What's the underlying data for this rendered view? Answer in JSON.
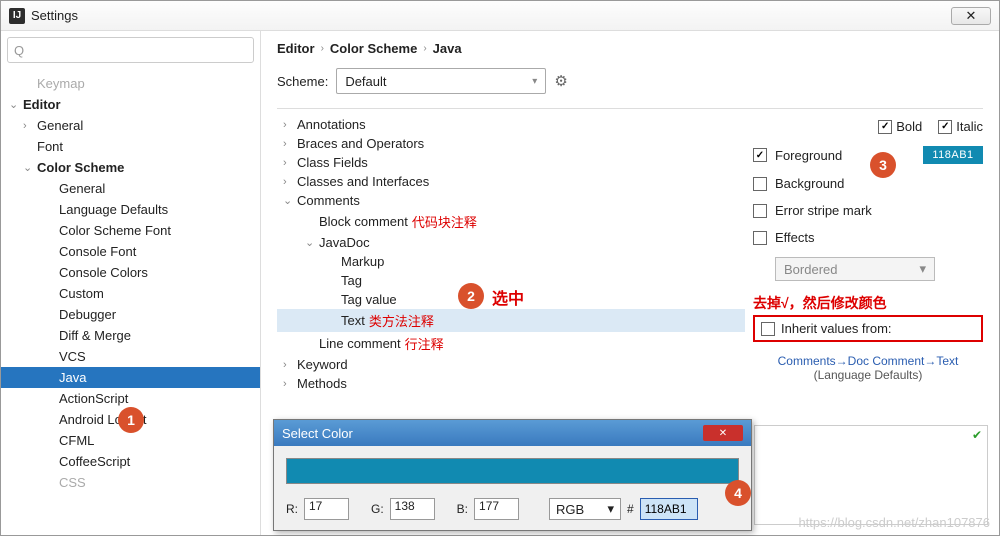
{
  "window": {
    "title": "Settings",
    "closeGlyph": "✕"
  },
  "search": {
    "placeholder": "Q"
  },
  "sidebar": {
    "items": [
      {
        "label": "Keymap",
        "depth": 1,
        "faded": true
      },
      {
        "label": "Editor",
        "depth": 0,
        "arrow": "v",
        "bold": true
      },
      {
        "label": "General",
        "depth": 1,
        "arrow": ">"
      },
      {
        "label": "Font",
        "depth": 1
      },
      {
        "label": "Color Scheme",
        "depth": 1,
        "arrow": "v",
        "bold": true
      },
      {
        "label": "General",
        "depth": 2
      },
      {
        "label": "Language Defaults",
        "depth": 2
      },
      {
        "label": "Color Scheme Font",
        "depth": 2
      },
      {
        "label": "Console Font",
        "depth": 2
      },
      {
        "label": "Console Colors",
        "depth": 2
      },
      {
        "label": "Custom",
        "depth": 2
      },
      {
        "label": "Debugger",
        "depth": 2
      },
      {
        "label": "Diff & Merge",
        "depth": 2
      },
      {
        "label": "VCS",
        "depth": 2
      },
      {
        "label": "Java",
        "depth": 2,
        "selected": true
      },
      {
        "label": "ActionScript",
        "depth": 2
      },
      {
        "label": "Android Logcat",
        "depth": 2
      },
      {
        "label": "CFML",
        "depth": 2
      },
      {
        "label": "CoffeeScript",
        "depth": 2
      },
      {
        "label": "CSS",
        "depth": 2,
        "faded": true
      }
    ]
  },
  "breadcrumb": {
    "a": "Editor",
    "b": "Color Scheme",
    "c": "Java"
  },
  "scheme": {
    "label": "Scheme:",
    "value": "Default"
  },
  "optionsTree": [
    {
      "label": "Annotations",
      "depth": 0,
      "arrow": ">"
    },
    {
      "label": "Braces and Operators",
      "depth": 0,
      "arrow": ">"
    },
    {
      "label": "Class Fields",
      "depth": 0,
      "arrow": ">"
    },
    {
      "label": "Classes and Interfaces",
      "depth": 0,
      "arrow": ">"
    },
    {
      "label": "Comments",
      "depth": 0,
      "arrow": "v"
    },
    {
      "label": "Block comment",
      "depth": 1,
      "note": "代码块注释"
    },
    {
      "label": "JavaDoc",
      "depth": 1,
      "arrow": "v"
    },
    {
      "label": "Markup",
      "depth": 2
    },
    {
      "label": "Tag",
      "depth": 2
    },
    {
      "label": "Tag value",
      "depth": 2
    },
    {
      "label": "Text",
      "depth": 2,
      "selected": true,
      "note": "类方法注释"
    },
    {
      "label": "Line comment",
      "depth": 1,
      "note": "行注释"
    },
    {
      "label": "Keyword",
      "depth": 0,
      "arrow": ">"
    },
    {
      "label": "Methods",
      "depth": 0,
      "arrow": ">"
    }
  ],
  "props": {
    "bold": "Bold",
    "italic": "Italic",
    "foreground": "Foreground",
    "fgColor": "118AB1",
    "background": "Background",
    "errorStripe": "Error stripe mark",
    "effects": "Effects",
    "effectsType": "Bordered",
    "inheritRed": "去掉√，然后修改颜色",
    "inheritLabel": "Inherit values from:",
    "linkPath": "Comments→Doc Comment→Text",
    "langDefaults": "(Language Defaults)"
  },
  "annotations": {
    "n1": "1",
    "n2": "2",
    "n2txt": "选中",
    "n3": "3",
    "n4": "4"
  },
  "colorDialog": {
    "title": "Select Color",
    "r": "17",
    "g": "138",
    "b": "177",
    "rl": "R:",
    "gl": "G:",
    "bl": "B:",
    "mode": "RGB",
    "hash": "#",
    "hex": "118AB1"
  },
  "watermark": "https://blog.csdn.net/zhan107876"
}
